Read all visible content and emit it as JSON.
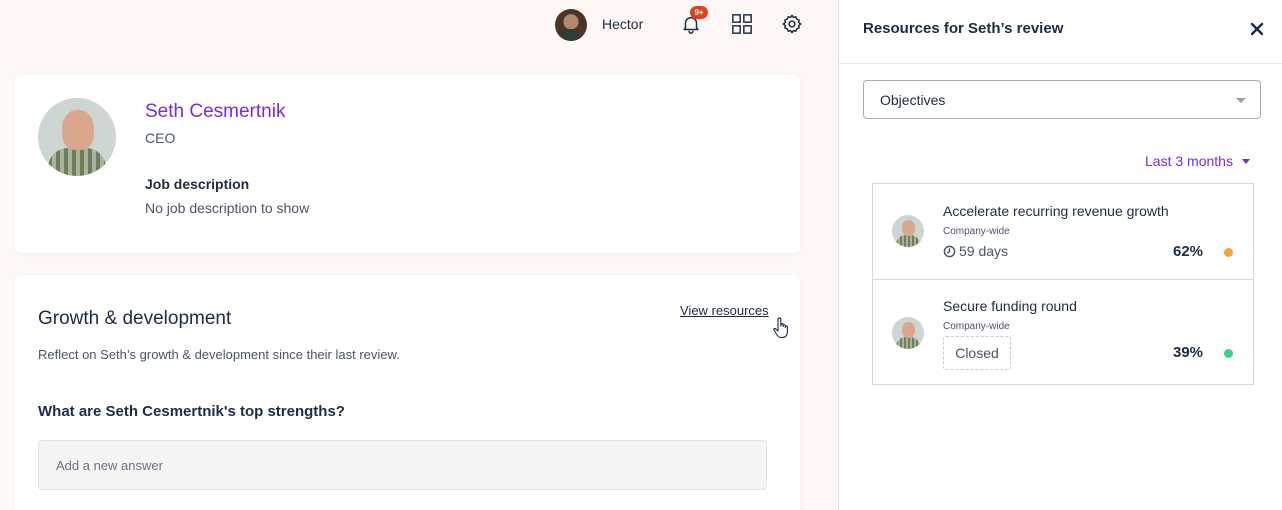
{
  "topbar": {
    "user_name": "Hector",
    "notification_badge": "9+",
    "icons": [
      "bell-icon",
      "apps-grid-icon",
      "gear-icon"
    ]
  },
  "profile": {
    "name": "Seth Cesmertnik",
    "role": "CEO",
    "job_heading": "Job description",
    "job_text": "No job description to show"
  },
  "growth": {
    "title": "Growth & development",
    "view_resources_label": "View resources",
    "subtitle": "Reflect on Seth’s growth & development since their last review.",
    "question": "What are Seth Cesmertnik's top strengths?",
    "answer_placeholder": "Add a new answer"
  },
  "panel": {
    "title": "Resources for Seth’s review",
    "select_value": "Objectives",
    "range_label": "Last 3 months",
    "objectives": [
      {
        "title": "Accelerate recurring revenue growth",
        "scope": "Company-wide",
        "status": "59 days",
        "status_type": "days",
        "percent": "62%",
        "dot_color": "#f2a33a"
      },
      {
        "title": "Secure funding round",
        "scope": "Company-wide",
        "status": "Closed",
        "status_type": "closed",
        "percent": "39%",
        "dot_color": "#3ccf8e"
      }
    ]
  },
  "colors": {
    "accent": "#7a2be2",
    "badge": "#e0411e",
    "text": "#1f2a44"
  }
}
